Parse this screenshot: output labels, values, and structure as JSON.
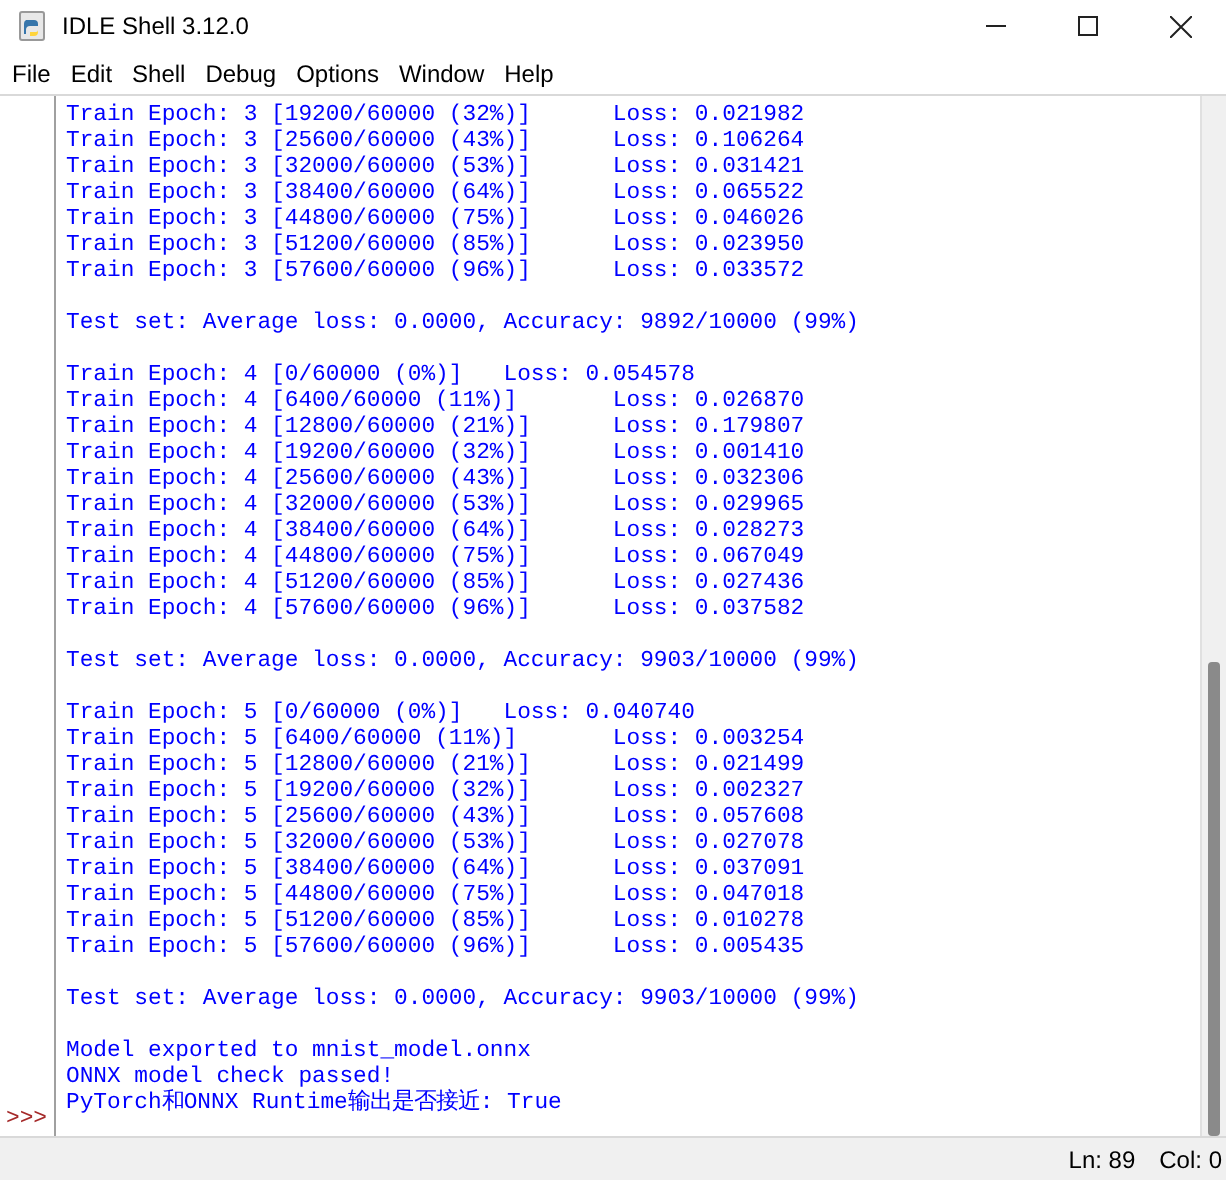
{
  "window": {
    "title": "IDLE Shell 3.12.0"
  },
  "menu": [
    "File",
    "Edit",
    "Shell",
    "Debug",
    "Options",
    "Window",
    "Help"
  ],
  "output_blocks": [
    [
      "Train Epoch: 3 [19200/60000 (32%)]\tLoss: 0.021982",
      "Train Epoch: 3 [25600/60000 (43%)]\tLoss: 0.106264",
      "Train Epoch: 3 [32000/60000 (53%)]\tLoss: 0.031421",
      "Train Epoch: 3 [38400/60000 (64%)]\tLoss: 0.065522",
      "Train Epoch: 3 [44800/60000 (75%)]\tLoss: 0.046026",
      "Train Epoch: 3 [51200/60000 (85%)]\tLoss: 0.023950",
      "Train Epoch: 3 [57600/60000 (96%)]\tLoss: 0.033572"
    ],
    [
      "Test set: Average loss: 0.0000, Accuracy: 9892/10000 (99%)"
    ],
    [
      "Train Epoch: 4 [0/60000 (0%)]\tLoss: 0.054578",
      "Train Epoch: 4 [6400/60000 (11%)]\tLoss: 0.026870",
      "Train Epoch: 4 [12800/60000 (21%)]\tLoss: 0.179807",
      "Train Epoch: 4 [19200/60000 (32%)]\tLoss: 0.001410",
      "Train Epoch: 4 [25600/60000 (43%)]\tLoss: 0.032306",
      "Train Epoch: 4 [32000/60000 (53%)]\tLoss: 0.029965",
      "Train Epoch: 4 [38400/60000 (64%)]\tLoss: 0.028273",
      "Train Epoch: 4 [44800/60000 (75%)]\tLoss: 0.067049",
      "Train Epoch: 4 [51200/60000 (85%)]\tLoss: 0.027436",
      "Train Epoch: 4 [57600/60000 (96%)]\tLoss: 0.037582"
    ],
    [
      "Test set: Average loss: 0.0000, Accuracy: 9903/10000 (99%)"
    ],
    [
      "Train Epoch: 5 [0/60000 (0%)]\tLoss: 0.040740",
      "Train Epoch: 5 [6400/60000 (11%)]\tLoss: 0.003254",
      "Train Epoch: 5 [12800/60000 (21%)]\tLoss: 0.021499",
      "Train Epoch: 5 [19200/60000 (32%)]\tLoss: 0.002327",
      "Train Epoch: 5 [25600/60000 (43%)]\tLoss: 0.057608",
      "Train Epoch: 5 [32000/60000 (53%)]\tLoss: 0.027078",
      "Train Epoch: 5 [38400/60000 (64%)]\tLoss: 0.037091",
      "Train Epoch: 5 [44800/60000 (75%)]\tLoss: 0.047018",
      "Train Epoch: 5 [51200/60000 (85%)]\tLoss: 0.010278",
      "Train Epoch: 5 [57600/60000 (96%)]\tLoss: 0.005435"
    ],
    [
      "Test set: Average loss: 0.0000, Accuracy: 9903/10000 (99%)"
    ],
    [
      "Model exported to mnist_model.onnx",
      "ONNX model check passed!",
      "PyTorch和ONNX Runtime输出是否接近: True"
    ]
  ],
  "prompt": ">>>",
  "status_bar": {
    "line": "Ln: 89",
    "column": "Col: 0"
  }
}
